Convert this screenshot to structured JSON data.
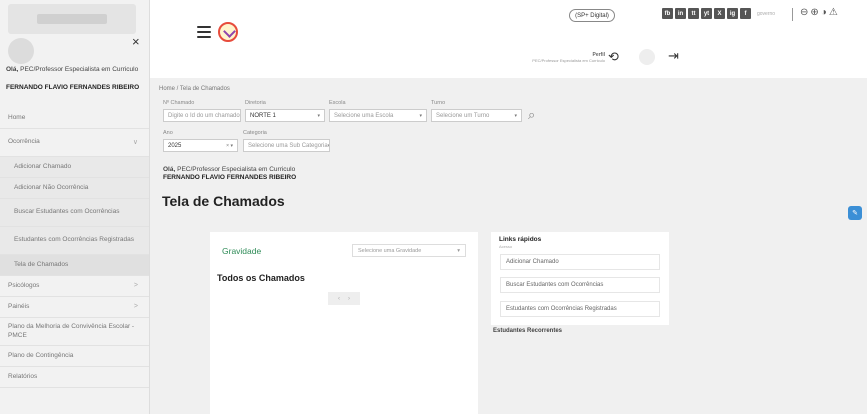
{
  "sidebar": {
    "close_symbol": "×",
    "greeting_prefix": "Olá,",
    "greeting_role": "PEC/Professor Especialista em Curriculo",
    "user_name": "FERNANDO FLAVIO FERNANDES RIBEIRO",
    "items": [
      {
        "label": "Home"
      },
      {
        "label": "Ocorrência",
        "chevron": "∨"
      },
      {
        "label": "Adicionar Chamado"
      },
      {
        "label": "Adicionar Não Ocorrência"
      },
      {
        "label": "Buscar Estudantes com Ocorrências"
      },
      {
        "label": "Estudantes com Ocorrências Registradas"
      },
      {
        "label": "Tela de Chamados"
      },
      {
        "label": "Psicólogos",
        "chevron": ">"
      },
      {
        "label": "Painéis",
        "chevron": ">"
      },
      {
        "label": "Plano da Melhoria de Convivência Escolar - PMCE"
      },
      {
        "label": "Plano de Contingência"
      },
      {
        "label": "Relatórios"
      }
    ]
  },
  "header": {
    "sp_digital": "(SP+ Digital)",
    "social_icons": [
      "fb",
      "in",
      "tt",
      "yt",
      "X",
      "ig",
      "f"
    ],
    "gov_text": "governo",
    "access_icons": [
      "⊖",
      "⊕",
      "◑",
      "⚠"
    ],
    "perfil_label": "Perfil",
    "perfil_value": "PEC/Professor Especialista em Curriculo",
    "profile_icon": "⟲",
    "logout_icon": "⇥"
  },
  "breadcrumb": "Home / Tela de Chamados",
  "filters": {
    "chamado_label": "Nº Chamado",
    "chamado_placeholder": "Digite o Id do um chamado",
    "diretoria_label": "Diretoria",
    "diretoria_value": "NORTE 1",
    "escola_label": "Escola",
    "escola_placeholder": "Selecione uma Escola",
    "turno_label": "Turno",
    "turno_placeholder": "Selecione um Turno",
    "ano_label": "Ano",
    "ano_value": "2025",
    "ano_controls": "× ▾",
    "categoria_label": "Categoria",
    "categoria_placeholder": "Selecione uma Sub Categoria",
    "search_icon": "⌕"
  },
  "content": {
    "greeting_prefix": "Olá,",
    "greeting_role": "PEC/Professor Especialista em Curriculo",
    "user_name": "FERNANDO FLAVIO FERNANDES RIBEIRO",
    "page_title": "Tela de Chamados",
    "gravidade_label": "Gravidade",
    "gravidade_placeholder": "Selecione uma Gravidade",
    "todos_title": "Todos os Chamados",
    "pager_prev": "‹",
    "pager_next": "›"
  },
  "links": {
    "title": "Links rápidos",
    "subtitle": "Acesso",
    "items": [
      "Adicionar Chamado",
      "Buscar Estudantes com Ocorrências",
      "Estudantes com Ocorrências Registradas"
    ],
    "recorrentes": "Estudantes Recorrentes"
  },
  "chat_icon": "✎"
}
